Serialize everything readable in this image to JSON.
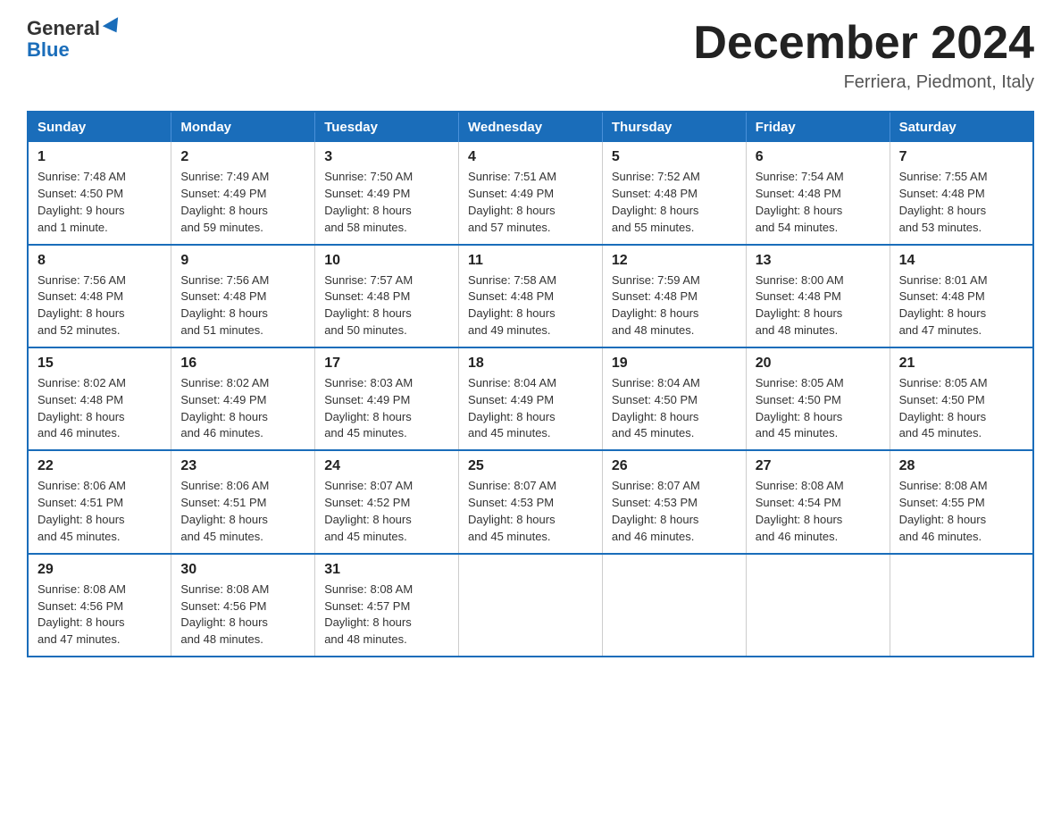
{
  "header": {
    "logo_general": "General",
    "logo_blue": "Blue",
    "month_title": "December 2024",
    "location": "Ferriera, Piedmont, Italy"
  },
  "weekdays": [
    "Sunday",
    "Monday",
    "Tuesday",
    "Wednesday",
    "Thursday",
    "Friday",
    "Saturday"
  ],
  "weeks": [
    [
      {
        "day": "1",
        "sunrise": "7:48 AM",
        "sunset": "4:50 PM",
        "daylight": "9 hours and 1 minute."
      },
      {
        "day": "2",
        "sunrise": "7:49 AM",
        "sunset": "4:49 PM",
        "daylight": "8 hours and 59 minutes."
      },
      {
        "day": "3",
        "sunrise": "7:50 AM",
        "sunset": "4:49 PM",
        "daylight": "8 hours and 58 minutes."
      },
      {
        "day": "4",
        "sunrise": "7:51 AM",
        "sunset": "4:49 PM",
        "daylight": "8 hours and 57 minutes."
      },
      {
        "day": "5",
        "sunrise": "7:52 AM",
        "sunset": "4:48 PM",
        "daylight": "8 hours and 55 minutes."
      },
      {
        "day": "6",
        "sunrise": "7:54 AM",
        "sunset": "4:48 PM",
        "daylight": "8 hours and 54 minutes."
      },
      {
        "day": "7",
        "sunrise": "7:55 AM",
        "sunset": "4:48 PM",
        "daylight": "8 hours and 53 minutes."
      }
    ],
    [
      {
        "day": "8",
        "sunrise": "7:56 AM",
        "sunset": "4:48 PM",
        "daylight": "8 hours and 52 minutes."
      },
      {
        "day": "9",
        "sunrise": "7:56 AM",
        "sunset": "4:48 PM",
        "daylight": "8 hours and 51 minutes."
      },
      {
        "day": "10",
        "sunrise": "7:57 AM",
        "sunset": "4:48 PM",
        "daylight": "8 hours and 50 minutes."
      },
      {
        "day": "11",
        "sunrise": "7:58 AM",
        "sunset": "4:48 PM",
        "daylight": "8 hours and 49 minutes."
      },
      {
        "day": "12",
        "sunrise": "7:59 AM",
        "sunset": "4:48 PM",
        "daylight": "8 hours and 48 minutes."
      },
      {
        "day": "13",
        "sunrise": "8:00 AM",
        "sunset": "4:48 PM",
        "daylight": "8 hours and 48 minutes."
      },
      {
        "day": "14",
        "sunrise": "8:01 AM",
        "sunset": "4:48 PM",
        "daylight": "8 hours and 47 minutes."
      }
    ],
    [
      {
        "day": "15",
        "sunrise": "8:02 AM",
        "sunset": "4:48 PM",
        "daylight": "8 hours and 46 minutes."
      },
      {
        "day": "16",
        "sunrise": "8:02 AM",
        "sunset": "4:49 PM",
        "daylight": "8 hours and 46 minutes."
      },
      {
        "day": "17",
        "sunrise": "8:03 AM",
        "sunset": "4:49 PM",
        "daylight": "8 hours and 45 minutes."
      },
      {
        "day": "18",
        "sunrise": "8:04 AM",
        "sunset": "4:49 PM",
        "daylight": "8 hours and 45 minutes."
      },
      {
        "day": "19",
        "sunrise": "8:04 AM",
        "sunset": "4:50 PM",
        "daylight": "8 hours and 45 minutes."
      },
      {
        "day": "20",
        "sunrise": "8:05 AM",
        "sunset": "4:50 PM",
        "daylight": "8 hours and 45 minutes."
      },
      {
        "day": "21",
        "sunrise": "8:05 AM",
        "sunset": "4:50 PM",
        "daylight": "8 hours and 45 minutes."
      }
    ],
    [
      {
        "day": "22",
        "sunrise": "8:06 AM",
        "sunset": "4:51 PM",
        "daylight": "8 hours and 45 minutes."
      },
      {
        "day": "23",
        "sunrise": "8:06 AM",
        "sunset": "4:51 PM",
        "daylight": "8 hours and 45 minutes."
      },
      {
        "day": "24",
        "sunrise": "8:07 AM",
        "sunset": "4:52 PM",
        "daylight": "8 hours and 45 minutes."
      },
      {
        "day": "25",
        "sunrise": "8:07 AM",
        "sunset": "4:53 PM",
        "daylight": "8 hours and 45 minutes."
      },
      {
        "day": "26",
        "sunrise": "8:07 AM",
        "sunset": "4:53 PM",
        "daylight": "8 hours and 46 minutes."
      },
      {
        "day": "27",
        "sunrise": "8:08 AM",
        "sunset": "4:54 PM",
        "daylight": "8 hours and 46 minutes."
      },
      {
        "day": "28",
        "sunrise": "8:08 AM",
        "sunset": "4:55 PM",
        "daylight": "8 hours and 46 minutes."
      }
    ],
    [
      {
        "day": "29",
        "sunrise": "8:08 AM",
        "sunset": "4:56 PM",
        "daylight": "8 hours and 47 minutes."
      },
      {
        "day": "30",
        "sunrise": "8:08 AM",
        "sunset": "4:56 PM",
        "daylight": "8 hours and 48 minutes."
      },
      {
        "day": "31",
        "sunrise": "8:08 AM",
        "sunset": "4:57 PM",
        "daylight": "8 hours and 48 minutes."
      },
      null,
      null,
      null,
      null
    ]
  ]
}
